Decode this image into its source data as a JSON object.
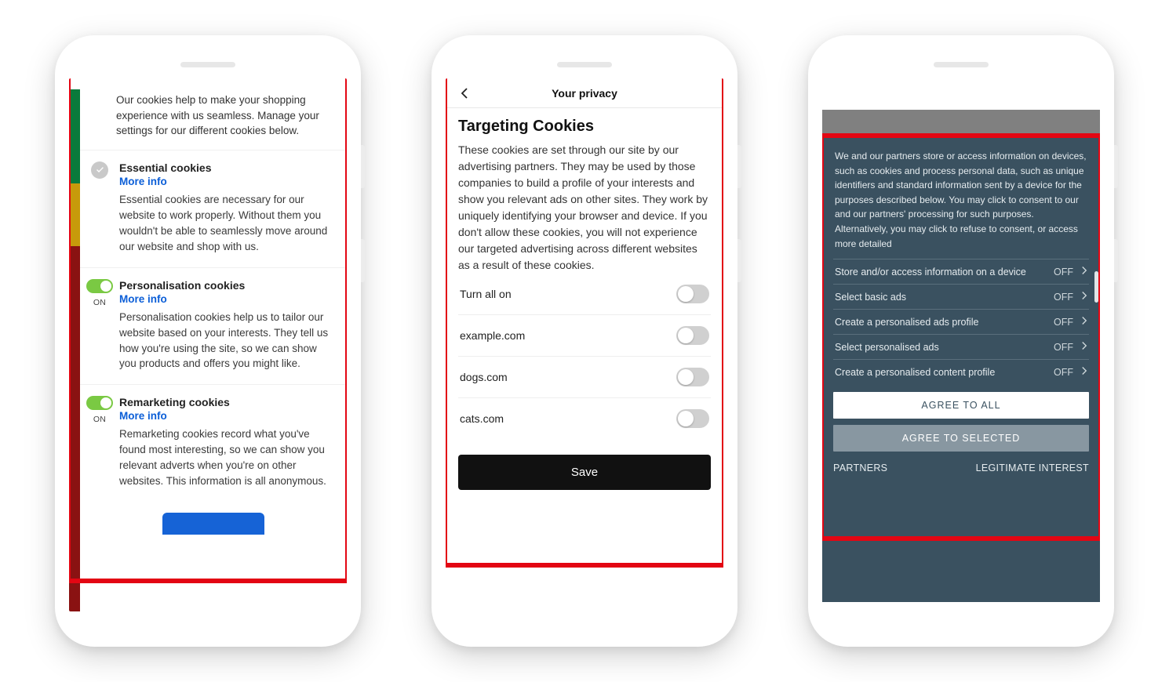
{
  "phone1": {
    "intro": "Our cookies help to make your shopping experience with us seamless. Manage your settings for our different cookies below.",
    "more_info": "More info",
    "on_label": "ON",
    "sections": {
      "essential": {
        "title": "Essential cookies",
        "desc": "Essential cookies are necessary for our website to work properly. Without them you wouldn't be able to seamlessly move around our website and shop with us."
      },
      "personalisation": {
        "title": "Personalisation cookies",
        "desc": "Personalisation cookies help us to tailor our website based on your interests. They tell us how you're using the site, so we can show you products and offers you might like."
      },
      "remarketing": {
        "title": "Remarketing cookies",
        "desc": "Remarketing cookies record what you've found most interesting, so we can show you relevant adverts when you're on other websites. This information is all anonymous."
      }
    }
  },
  "phone2": {
    "header": "Your privacy",
    "title": "Targeting Cookies",
    "desc": "These cookies are set through our site by our advertising partners. They may be used by those companies to build a profile of your interests and show you relevant ads on other sites. They work by uniquely identifying your browser and device. If you don't allow these cookies, you will not experience our targeted advertising across different websites as a result of these cookies.",
    "turn_all": "Turn all on",
    "rows": [
      "example.com",
      "dogs.com",
      "cats.com"
    ],
    "save": "Save"
  },
  "phone3": {
    "text": "We and our partners store or access information on devices, such as cookies and process personal data, such as unique identifiers and standard information sent by a device for the purposes described below. You may click to consent to our and our partners' processing for such purposes. Alternatively, you may click to refuse to consent, or access more detailed",
    "off": "OFF",
    "rows": [
      "Store and/or access information on a device",
      "Select basic ads",
      "Create a personalised ads profile",
      "Select personalised ads",
      "Create a personalised content profile"
    ],
    "agree_all": "AGREE TO ALL",
    "agree_sel": "AGREE TO SELECTED",
    "partners": "PARTNERS",
    "legit": "LEGITIMATE INTEREST"
  }
}
